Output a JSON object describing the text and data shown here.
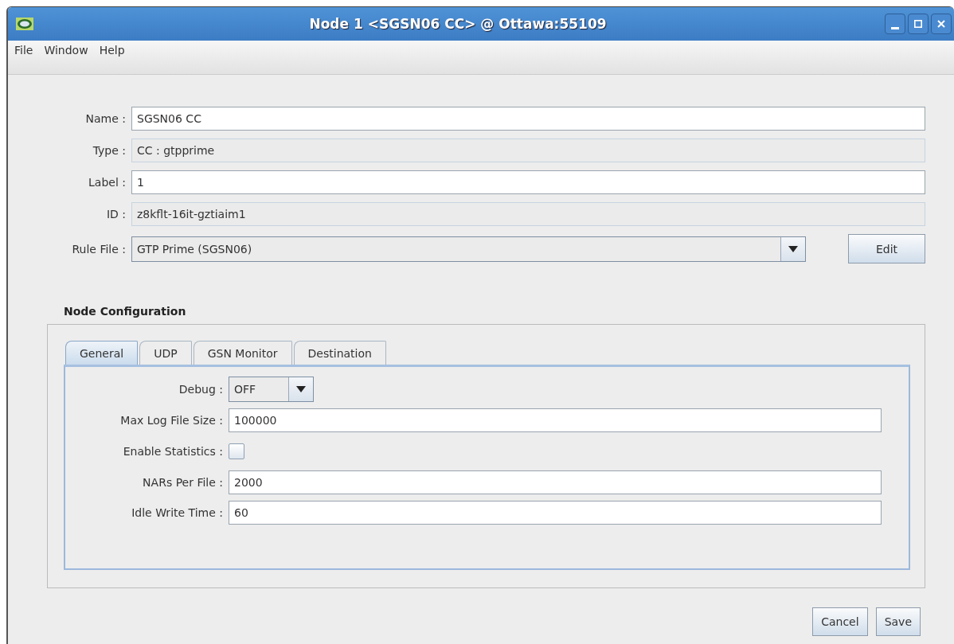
{
  "window": {
    "title": "Node 1 <SGSN06 CC> @ Ottawa:55109"
  },
  "menu": [
    "File",
    "Window",
    "Help"
  ],
  "fields": [
    {
      "kind": "text",
      "label": "Name :",
      "value": "SGSN06 CC"
    },
    {
      "kind": "readonly",
      "label": "Type :",
      "value": "CC : gtpprime"
    },
    {
      "kind": "text",
      "label": "Label :",
      "value": "1"
    },
    {
      "kind": "readonly",
      "label": "ID :",
      "value": "z8kflt-16it-gztiaim1"
    },
    {
      "kind": "dropdown",
      "label": "Rule File :",
      "value": "GTP Prime (SGSN06)",
      "button": "Edit"
    }
  ],
  "section": {
    "title": "Node Configuration"
  },
  "tabs": [
    {
      "label": "General",
      "selected": true
    },
    {
      "label": "UDP",
      "selected": false
    },
    {
      "label": "GSN Monitor",
      "selected": false
    },
    {
      "label": "Destination",
      "selected": false
    }
  ],
  "settings": [
    {
      "kind": "dropdown",
      "label": "Debug :",
      "value": "OFF"
    },
    {
      "kind": "text",
      "label": "Max Log File Size :",
      "value": "100000"
    },
    {
      "kind": "checkbox",
      "label": "Enable Statistics :",
      "checked": false
    },
    {
      "kind": "text",
      "label": "NARs Per File :",
      "value": "2000"
    },
    {
      "kind": "text",
      "label": "Idle Write Time :",
      "value": "60"
    }
  ],
  "buttons": [
    "Cancel",
    "Save"
  ]
}
